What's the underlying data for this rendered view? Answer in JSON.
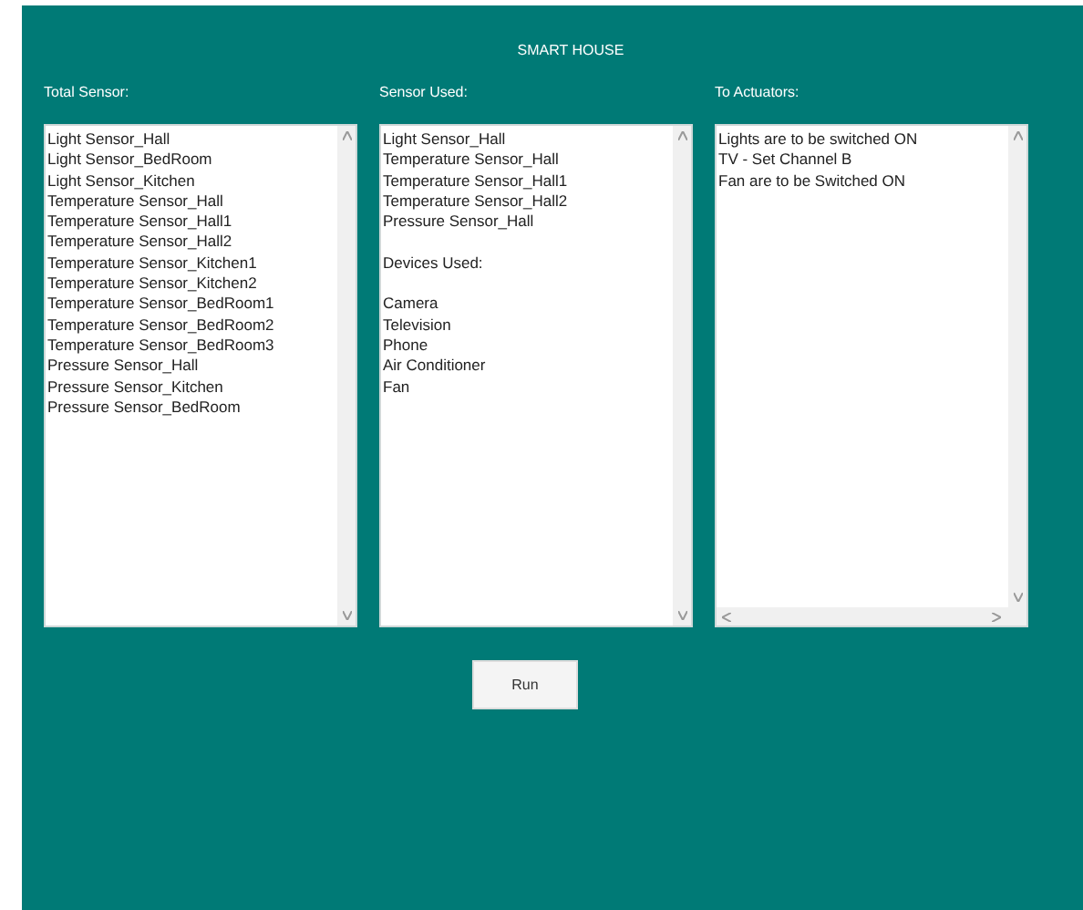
{
  "window": {
    "title": "SMART HOUSE"
  },
  "panels": [
    {
      "label": "Total Sensor:",
      "horizontal_scrollbar": false,
      "sections": [
        [
          "Light Sensor_Hall",
          "Light Sensor_BedRoom",
          "Light Sensor_Kitchen",
          "Temperature Sensor_Hall",
          "Temperature Sensor_Hall1",
          "Temperature Sensor_Hall2",
          "Temperature Sensor_Kitchen1",
          "Temperature Sensor_Kitchen2",
          "Temperature Sensor_BedRoom1",
          "Temperature Sensor_BedRoom2",
          "Temperature Sensor_BedRoom3",
          "Pressure Sensor_Hall",
          "Pressure Sensor_Kitchen",
          "Pressure Sensor_BedRoom"
        ]
      ]
    },
    {
      "label": "Sensor Used:",
      "horizontal_scrollbar": false,
      "sections": [
        [
          "Light Sensor_Hall",
          "Temperature Sensor_Hall",
          "Temperature Sensor_Hall1",
          "Temperature Sensor_Hall2",
          "Pressure Sensor_Hall"
        ],
        [
          "Devices Used:"
        ],
        [
          "Camera",
          "Television",
          "Phone",
          "Air Conditioner",
          "Fan"
        ]
      ]
    },
    {
      "label": "To Actuators:",
      "horizontal_scrollbar": true,
      "sections": [
        [
          "Lights are to be switched ON",
          "TV - Set Channel B",
          "Fan are to be  Switched ON"
        ]
      ]
    }
  ],
  "run_button": {
    "label": "Run"
  }
}
